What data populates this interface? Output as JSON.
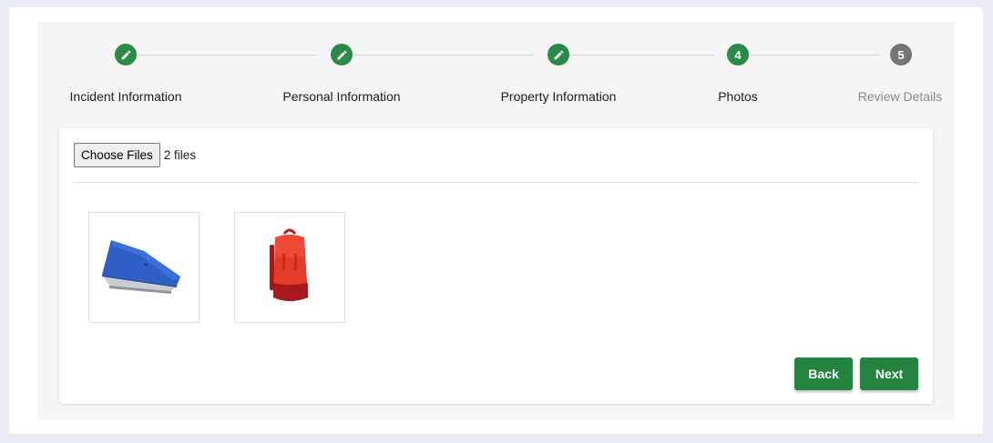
{
  "stepper": {
    "steps": [
      {
        "label": "Incident Information",
        "state": "done",
        "number": ""
      },
      {
        "label": "Personal Information",
        "state": "done",
        "number": ""
      },
      {
        "label": "Property Information",
        "state": "done",
        "number": ""
      },
      {
        "label": "Photos",
        "state": "active",
        "number": "4"
      },
      {
        "label": "Review Details",
        "state": "pending",
        "number": "5"
      }
    ],
    "done_icon": "pencil-icon"
  },
  "upload": {
    "button_label": "Choose Files",
    "file_count": "2 files"
  },
  "photos": [
    {
      "name": "laptop-photo",
      "subject": "blue laptop"
    },
    {
      "name": "backpack-photo",
      "subject": "red backpack"
    }
  ],
  "actions": {
    "back_label": "Back",
    "next_label": "Next"
  },
  "colors": {
    "accent": "#22843f",
    "pending": "#757575"
  }
}
